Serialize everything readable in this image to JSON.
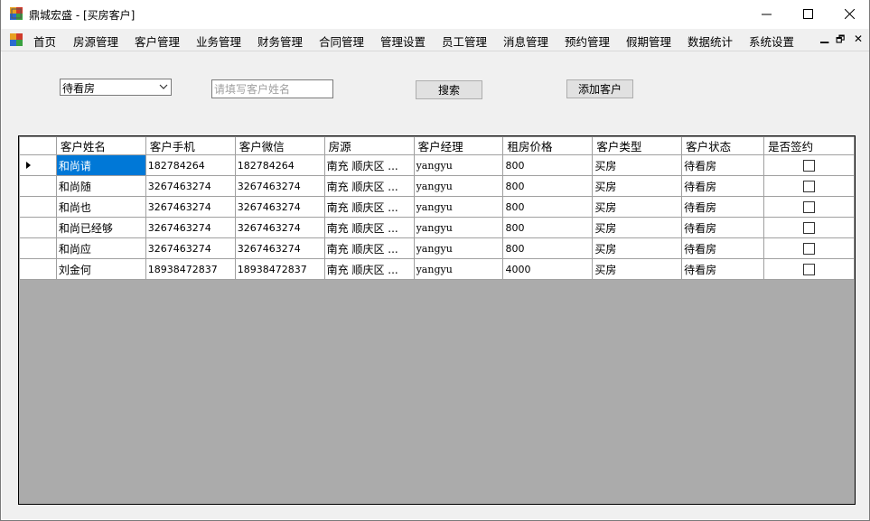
{
  "window": {
    "title": "鼎城宏盛 - [买房客户]",
    "minimize_glyph": "—",
    "maximize_glyph": "☐",
    "close_glyph": "✕"
  },
  "menu": {
    "items": [
      "首页",
      "房源管理",
      "客户管理",
      "业务管理",
      "财务管理",
      "合同管理",
      "管理设置",
      "员工管理",
      "消息管理",
      "预约管理",
      "假期管理",
      "数据统计",
      "系统设置"
    ],
    "mdi_min": "▁",
    "mdi_restore": "🗗",
    "mdi_close": "✕"
  },
  "filter": {
    "status_selected": "待看房",
    "name_placeholder": "请填写客户姓名",
    "name_value": "",
    "search_label": "搜索",
    "add_label": "添加客户"
  },
  "grid": {
    "columns": [
      "客户姓名",
      "客户手机",
      "客户微信",
      "房源",
      "客户经理",
      "租房价格",
      "客户类型",
      "客户状态",
      "是否签约"
    ],
    "rows": [
      {
        "name": "和尚请",
        "phone": "182784264",
        "wechat": "182784264",
        "house": "南充 顺庆区 ...",
        "manager": "yangyu",
        "price": "800",
        "type": "买房",
        "status": "待看房",
        "signed": false
      },
      {
        "name": "和尚随",
        "phone": "3267463274",
        "wechat": "3267463274",
        "house": "南充 顺庆区 ...",
        "manager": "yangyu",
        "price": "800",
        "type": "买房",
        "status": "待看房",
        "signed": false
      },
      {
        "name": "和尚也",
        "phone": "3267463274",
        "wechat": "3267463274",
        "house": "南充 顺庆区 ...",
        "manager": "yangyu",
        "price": "800",
        "type": "买房",
        "status": "待看房",
        "signed": false
      },
      {
        "name": "和尚已经够",
        "phone": "3267463274",
        "wechat": "3267463274",
        "house": "南充 顺庆区 ...",
        "manager": "yangyu",
        "price": "800",
        "type": "买房",
        "status": "待看房",
        "signed": false
      },
      {
        "name": "和尚应",
        "phone": "3267463274",
        "wechat": "3267463274",
        "house": "南充 顺庆区 ...",
        "manager": "yangyu",
        "price": "800",
        "type": "买房",
        "status": "待看房",
        "signed": false
      },
      {
        "name": "刘金何",
        "phone": "18938472837",
        "wechat": "18938472837",
        "house": "南充 顺庆区 ...",
        "manager": "yangyu",
        "price": "4000",
        "type": "买房",
        "status": "待看房",
        "signed": false
      }
    ]
  },
  "colors": {
    "selection": "#0078d7",
    "client_bg": "#f0f0f0",
    "grid_bg": "#ababab"
  }
}
